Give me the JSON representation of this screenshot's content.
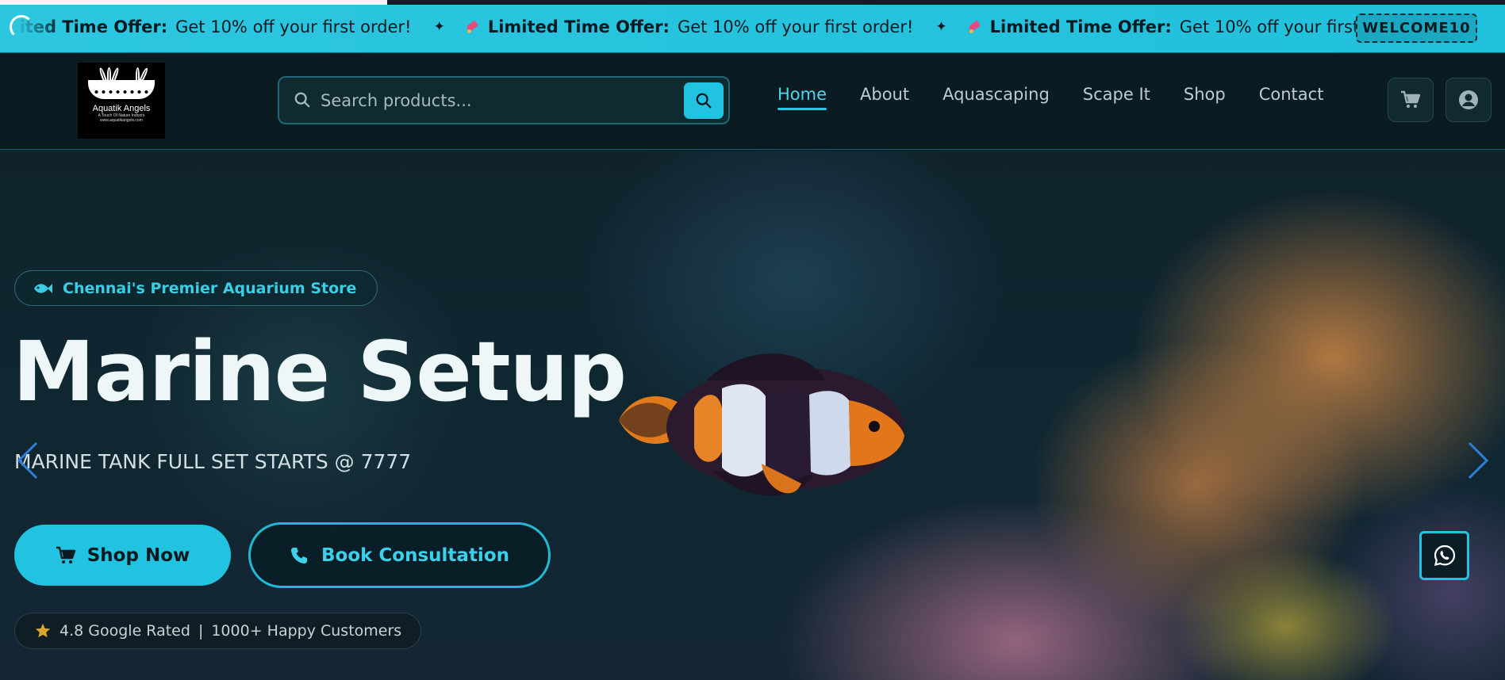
{
  "promo": {
    "prefix": "Limited Time Offer:",
    "message": "Get 10% off your first order!",
    "separator": "✦",
    "coupon_code": "WELCOME10"
  },
  "header": {
    "logo": {
      "name": "Aquatik Angels",
      "tagline": "A Touch Of Nature Indoors",
      "url_text": "www.aquatikangels.com"
    },
    "search": {
      "placeholder": "Search products..."
    },
    "nav": [
      {
        "label": "Home",
        "active": true
      },
      {
        "label": "About",
        "active": false
      },
      {
        "label": "Aquascaping",
        "active": false
      },
      {
        "label": "Scape It",
        "active": false
      },
      {
        "label": "Shop",
        "active": false
      },
      {
        "label": "Contact",
        "active": false
      }
    ]
  },
  "hero": {
    "badge": "Chennai's Premier Aquarium Store",
    "title": "Marine Setup",
    "subtitle": "MARINE TANK FULL SET STARTS @ 7777",
    "primary_button": "Shop Now",
    "secondary_button": "Book Consultation",
    "rating_text": "4.8 Google Rated",
    "rating_separator": "|",
    "customers_text": "1000+ Happy Customers"
  },
  "colors": {
    "accent": "#22c3e0",
    "dark": "#0a1b22",
    "promo_bg": "#2cc6df"
  },
  "icons": [
    "spinner-icon",
    "rocket-icon",
    "search-icon",
    "cart-icon",
    "user-icon",
    "fish-icon",
    "phone-icon",
    "star-icon",
    "chevron-left-icon",
    "chevron-right-icon",
    "whatsapp-icon"
  ]
}
